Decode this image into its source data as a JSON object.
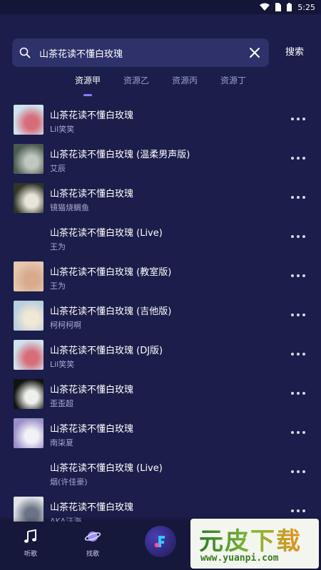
{
  "status_bar": {
    "time": "5:25",
    "wifi_icon": "wifi-icon",
    "sim_icon": "sim-icon",
    "battery_icon": "battery-icon"
  },
  "search": {
    "value": "山茶花读不懂白玫瑰",
    "button_label": "搜索"
  },
  "tabs": [
    {
      "label": "资源甲",
      "active": true
    },
    {
      "label": "资源乙",
      "active": false
    },
    {
      "label": "资源丙",
      "active": false
    },
    {
      "label": "资源丁",
      "active": false
    }
  ],
  "songs": [
    {
      "title": "山茶花读不懂白玫瑰",
      "artist": "Lil笑笑",
      "cover_colors": [
        "#cfe3ee",
        "#d86d7a"
      ]
    },
    {
      "title": "山茶花读不懂白玫瑰 (温柔男声版)",
      "artist": "艾辰",
      "cover_colors": [
        "#4c5a4e",
        "#bfc7c0"
      ]
    },
    {
      "title": "山茶花读不懂白玫瑰",
      "artist": "镜猫烧鲷鱼",
      "cover_colors": [
        "#2f3528",
        "#e8e4da"
      ]
    },
    {
      "title": "山茶花读不懂白玫瑰 (Live)",
      "artist": "王为",
      "cover_colors": null
    },
    {
      "title": "山茶花读不懂白玫瑰 (教室版)",
      "artist": "王为",
      "cover_colors": [
        "#e7c7ad",
        "#d8a98a"
      ]
    },
    {
      "title": "山茶花读不懂白玫瑰 (吉他版)",
      "artist": "柯柯柯啊",
      "cover_colors": [
        "#b9cfdf",
        "#f2e8d6"
      ]
    },
    {
      "title": "山茶花读不懂白玫瑰 (DJ版)",
      "artist": "Lil笑笑",
      "cover_colors": [
        "#cfe3ee",
        "#d86d7a"
      ]
    },
    {
      "title": "山茶花读不懂白玫瑰",
      "artist": "歪歪超",
      "cover_colors": [
        "#101410",
        "#eef0ea"
      ]
    },
    {
      "title": "山茶花读不懂白玫瑰",
      "artist": "南柒夏",
      "cover_colors": [
        "#9a8fc9",
        "#f3f1f8"
      ]
    },
    {
      "title": "山茶花读不懂白玫瑰 (Live)",
      "artist": "烟(许佳豪)",
      "cover_colors": null
    },
    {
      "title": "山茶花读不懂白玫瑰",
      "artist": "AKA汪海",
      "cover_colors": [
        "#dfe2e6",
        "#6a7486"
      ]
    }
  ],
  "bottom_nav": [
    {
      "label": "听歌",
      "icon": "music-note-icon"
    },
    {
      "label": "找歌",
      "icon": "planet-icon"
    },
    {
      "label": "",
      "icon": "app-logo-icon"
    }
  ],
  "watermark": {
    "main": "元皮下载",
    "sub": "www.yuanpi.com"
  },
  "colors": {
    "background": "#1b1d4a",
    "search_bg": "#2e316a",
    "accent": "#8a7cff",
    "muted_text": "#a6abd1"
  }
}
